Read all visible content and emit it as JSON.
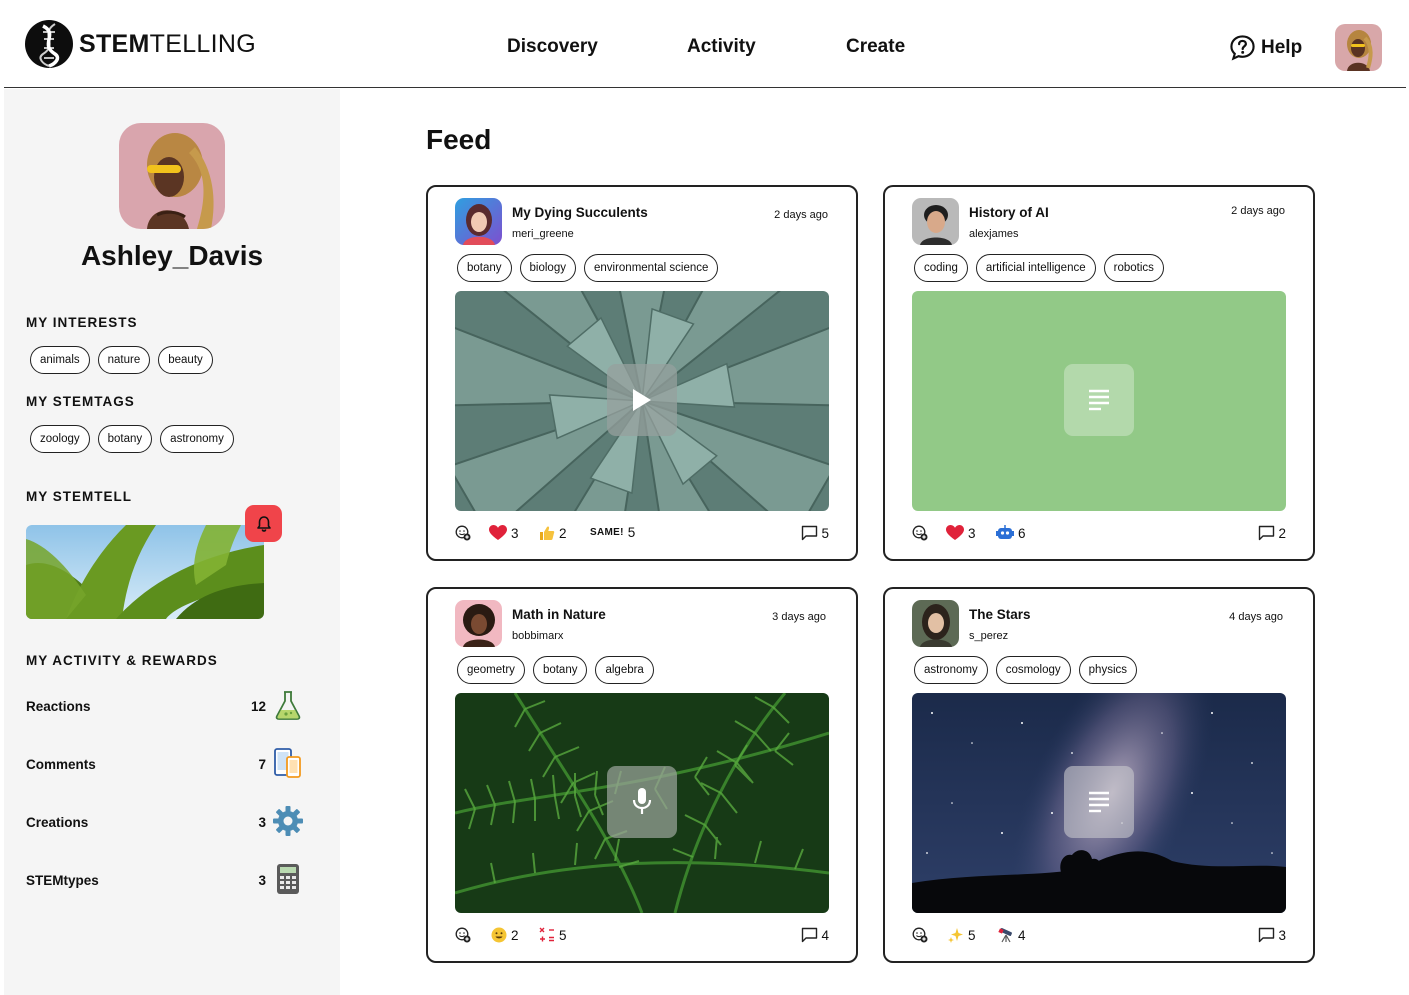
{
  "brand": {
    "bold": "STEM",
    "light": "TELLING"
  },
  "nav": {
    "discovery": "Discovery",
    "activity": "Activity",
    "create": "Create",
    "help": "Help"
  },
  "profile": {
    "name": "Ashley_Davis"
  },
  "sidebar": {
    "interests_title": "MY INTERESTS",
    "interests": [
      "animals",
      "nature",
      "beauty"
    ],
    "stemtags_title": "MY STEMTAGS",
    "stemtags": [
      "zoology",
      "botany",
      "astronomy"
    ],
    "stemtell_title": "MY STEMTELL",
    "activity_title": "MY ACTIVITY & REWARDS",
    "stats": [
      {
        "label": "Reactions",
        "value": "12",
        "icon": "flask-icon"
      },
      {
        "label": "Comments",
        "value": "7",
        "icon": "devices-icon"
      },
      {
        "label": "Creations",
        "value": "3",
        "icon": "gear-icon"
      },
      {
        "label": "STEMtypes",
        "value": "3",
        "icon": "calculator-icon"
      }
    ]
  },
  "feed": {
    "title": "Feed",
    "posts": [
      {
        "title": "My Dying Succulents",
        "user": "meri_greene",
        "time": "2 days ago",
        "tags": [
          "botany",
          "biology",
          "environmental science"
        ],
        "media": "video",
        "media_icon": "play-icon",
        "reactions": [
          {
            "emoji": "heart",
            "count": "3"
          },
          {
            "emoji": "thumbs-up",
            "count": "2"
          },
          {
            "emoji": "same",
            "label": "SAME!",
            "count": "5"
          }
        ],
        "comments": "5"
      },
      {
        "title": "History of AI",
        "user": "alexjames",
        "time": "2 days ago",
        "tags": [
          "coding",
          "artificial intelligence",
          "robotics"
        ],
        "media": "document",
        "media_icon": "document-icon",
        "reactions": [
          {
            "emoji": "heart",
            "count": "3"
          },
          {
            "emoji": "robot",
            "count": "6"
          }
        ],
        "comments": "2"
      },
      {
        "title": "Math in Nature",
        "user": "bobbimarx",
        "time": "3 days ago",
        "tags": [
          "geometry",
          "botany",
          "algebra"
        ],
        "media": "audio",
        "media_icon": "microphone-icon",
        "reactions": [
          {
            "emoji": "smile",
            "count": "2"
          },
          {
            "emoji": "math",
            "count": "5"
          }
        ],
        "comments": "4"
      },
      {
        "title": "The Stars",
        "user": "s_perez",
        "time": "4 days ago",
        "tags": [
          "astronomy",
          "cosmology",
          "physics"
        ],
        "media": "document",
        "media_icon": "document-icon",
        "reactions": [
          {
            "emoji": "sparkles",
            "count": "5"
          },
          {
            "emoji": "telescope",
            "count": "4"
          }
        ],
        "comments": "3"
      }
    ]
  },
  "colors": {
    "accent_red": "#f0444a",
    "doc_green": "#92c987",
    "heart": "#e0223a"
  }
}
